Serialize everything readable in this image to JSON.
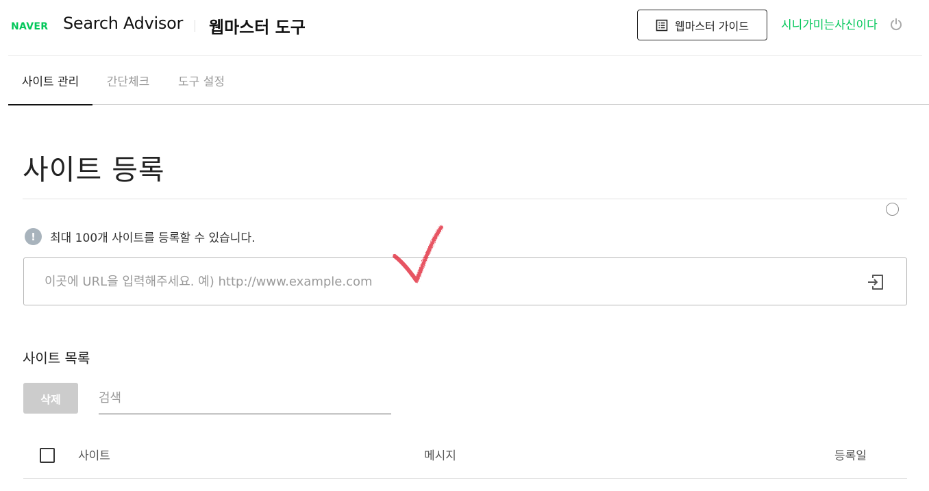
{
  "header": {
    "logo": "NAVER",
    "service_name": "Search Advisor",
    "tool_name": "웹마스터 도구",
    "guide_button": "웹마스터 가이드",
    "user_name": "시니가미는사신이다",
    "icons": {
      "guide": "document-list-icon",
      "logout": "power-icon"
    }
  },
  "tabs": [
    {
      "label": "사이트 관리",
      "active": true
    },
    {
      "label": "간단체크",
      "active": false
    },
    {
      "label": "도구 설정",
      "active": false
    }
  ],
  "register": {
    "title": "사이트 등록",
    "info": "최대 100개 사이트를 등록할 수 있습니다.",
    "info_icon": "!",
    "url_placeholder": "이곳에 URL을 입력해주세요. 예) http://www.example.com",
    "submit_icon": "enter-icon"
  },
  "site_list": {
    "title": "사이트 목록",
    "delete_button": "삭제",
    "search_placeholder": "검색",
    "columns": {
      "site": "사이트",
      "message": "메시지",
      "date": "등록일"
    }
  },
  "colors": {
    "brand": "#03c75a",
    "disabled_button": "#cccccc",
    "info_icon": "#a8b3bc",
    "check_annotation": "#e01e2e"
  }
}
